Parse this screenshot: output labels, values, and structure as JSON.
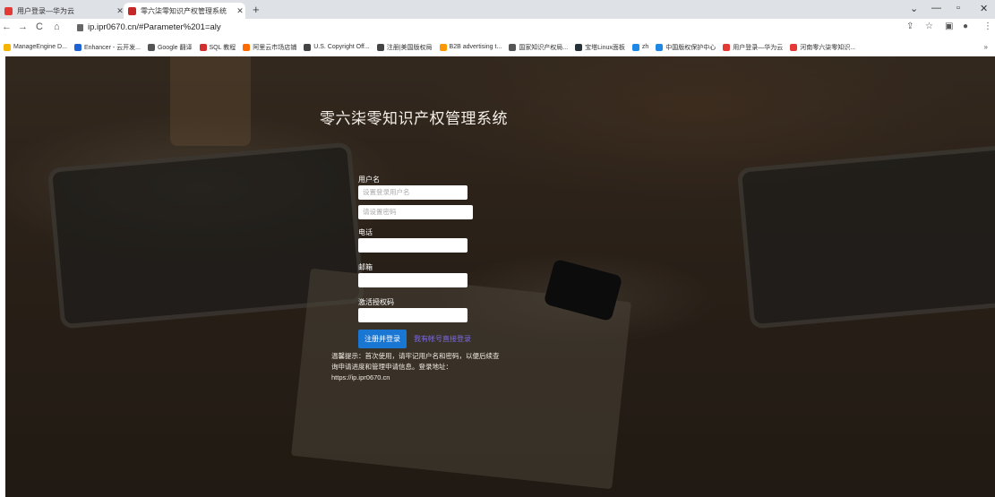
{
  "tabs": [
    {
      "title": "用户登录—华为云",
      "favicon_color": "#e53935"
    },
    {
      "title": "零六柒零知识产权管理系统",
      "favicon_color": "#c62828"
    }
  ],
  "new_tab": "+",
  "window_controls": {
    "dropdown": "⌄",
    "minimize": "—",
    "restore": "▫",
    "close": "✕"
  },
  "toolbar": {
    "back": "←",
    "forward": "→",
    "reload": "C",
    "home": "⌂",
    "url": "ip.ipr0670.cn/#Parameter%201=aly"
  },
  "bookmarks": [
    {
      "label": "ManageEngine D...",
      "color": "#f4b400"
    },
    {
      "label": "Enhancer - 云开发...",
      "color": "#1e63d6"
    },
    {
      "label": "Google 翻译",
      "color": "#555555"
    },
    {
      "label": "SQL 教程",
      "color": "#d32f2f"
    },
    {
      "label": "阿里云市场店铺",
      "color": "#ff6a00"
    },
    {
      "label": "U.S. Copyright Off...",
      "color": "#444444"
    },
    {
      "label": "注册|美国版权局",
      "color": "#444444"
    },
    {
      "label": "B2B advertising t...",
      "color": "#ff9800"
    },
    {
      "label": "国家知识产权局...",
      "color": "#555555"
    },
    {
      "label": "宝塔Linux面板",
      "color": "#263238"
    },
    {
      "label": "zh",
      "color": "#1e88e5"
    },
    {
      "label": "中国版权保护中心",
      "color": "#1e88e5"
    },
    {
      "label": "用户登录—华为云",
      "color": "#e53935"
    },
    {
      "label": "河南零六柒零知识...",
      "color": "#e53935"
    }
  ],
  "bookmarks_more": "»",
  "page": {
    "title": "零六柒零知识产权管理系统",
    "form": {
      "username_label": "用户名",
      "username_placeholder": "设置登录用户名",
      "password_placeholder": "请设置密码",
      "phone_label": "电话",
      "email_label": "邮箱",
      "activation_label": "激活授权码",
      "register_button": "注册并登录",
      "login_link": "我有帐号直接登录"
    },
    "tips": "温馨提示：首次使用，请牢记用户名和密码，以便后续查询申请进度和管理申请信息。登录地址：https://ip.ipr0670.cn"
  }
}
